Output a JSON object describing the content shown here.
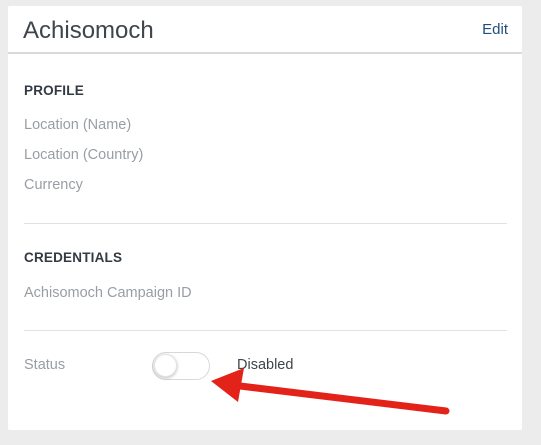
{
  "card": {
    "title": "Achisomoch",
    "edit_label": "Edit"
  },
  "profile": {
    "heading": "PROFILE",
    "fields": [
      "Location (Name)",
      "Location (Country)",
      "Currency"
    ]
  },
  "credentials": {
    "heading": "CREDENTIALS",
    "fields": [
      "Achisomoch Campaign ID"
    ]
  },
  "status": {
    "label": "Status",
    "toggle_on": false,
    "state_text": "Disabled"
  },
  "colors": {
    "annotation_arrow": "#e32219",
    "link": "#1f4f79"
  }
}
